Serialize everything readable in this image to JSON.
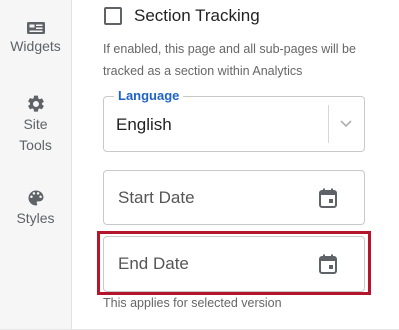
{
  "sidebar": {
    "items": [
      {
        "label": "Widgets",
        "icon": "widgets-icon"
      },
      {
        "label": "Site Tools",
        "icon": "gear-icon"
      },
      {
        "label": "Styles",
        "icon": "palette-icon"
      }
    ]
  },
  "section_tracking": {
    "label": "Section Tracking",
    "checked": false,
    "helper": "If enabled, this page and all sub-pages will be tracked as a section within Analytics"
  },
  "language": {
    "legend": "Language",
    "value": "English",
    "icon": "chevron-down-icon"
  },
  "start_date": {
    "placeholder": "Start Date",
    "icon": "calendar-icon"
  },
  "end_date": {
    "placeholder": "End Date",
    "icon": "calendar-icon"
  },
  "version_note": "This applies for selected version",
  "colors": {
    "accent": "#1e63c6",
    "highlight": "#b5152b",
    "icon": "#5f6368"
  }
}
